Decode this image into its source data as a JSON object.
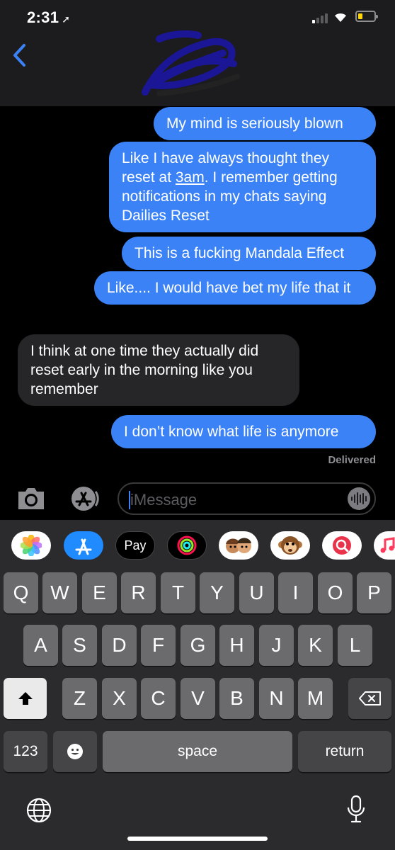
{
  "status_bar": {
    "time": "2:31",
    "location_glyph": "➚",
    "battery_color": "#ffd60a"
  },
  "header": {
    "back_icon": "chevron-left-icon",
    "contact_redacted": true
  },
  "messages": [
    {
      "dir": "out",
      "text": "My mind is seriously blown"
    },
    {
      "dir": "out",
      "text_parts": [
        "Like I have always thought they reset at ",
        "3am",
        ". I remember getting notifications in my chats saying Dailies Reset"
      ]
    },
    {
      "dir": "out",
      "text": "This is a fucking Mandala Effect"
    },
    {
      "dir": "out",
      "text": "Like.... I would have bet my life that it"
    },
    {
      "dir": "in",
      "text": "I think at one time they actually did reset early in the morning like you remember"
    },
    {
      "dir": "out",
      "text": "I don’t know what life is anymore"
    }
  ],
  "delivered_label": "Delivered",
  "input": {
    "placeholder": "iMessage"
  },
  "app_strip": [
    {
      "name": "photos-app-icon"
    },
    {
      "name": "app-store-icon"
    },
    {
      "name": "apple-pay-icon",
      "label": "Pay",
      "logo_glyph": ""
    },
    {
      "name": "activity-icon"
    },
    {
      "name": "memoji-icon"
    },
    {
      "name": "animoji-icon"
    },
    {
      "name": "images-search-icon"
    },
    {
      "name": "music-icon"
    }
  ],
  "keyboard": {
    "row1": [
      "Q",
      "W",
      "E",
      "R",
      "T",
      "Y",
      "U",
      "I",
      "O",
      "P"
    ],
    "row2": [
      "A",
      "S",
      "D",
      "F",
      "G",
      "H",
      "J",
      "K",
      "L"
    ],
    "row3": [
      "Z",
      "X",
      "C",
      "V",
      "B",
      "N",
      "M"
    ],
    "numbers_label": "123",
    "emoji_icon": "emoji-icon",
    "space_label": "space",
    "return_label": "return"
  },
  "colors": {
    "outgoing": "#3b82f6",
    "incoming": "#262628",
    "background": "#000000"
  }
}
